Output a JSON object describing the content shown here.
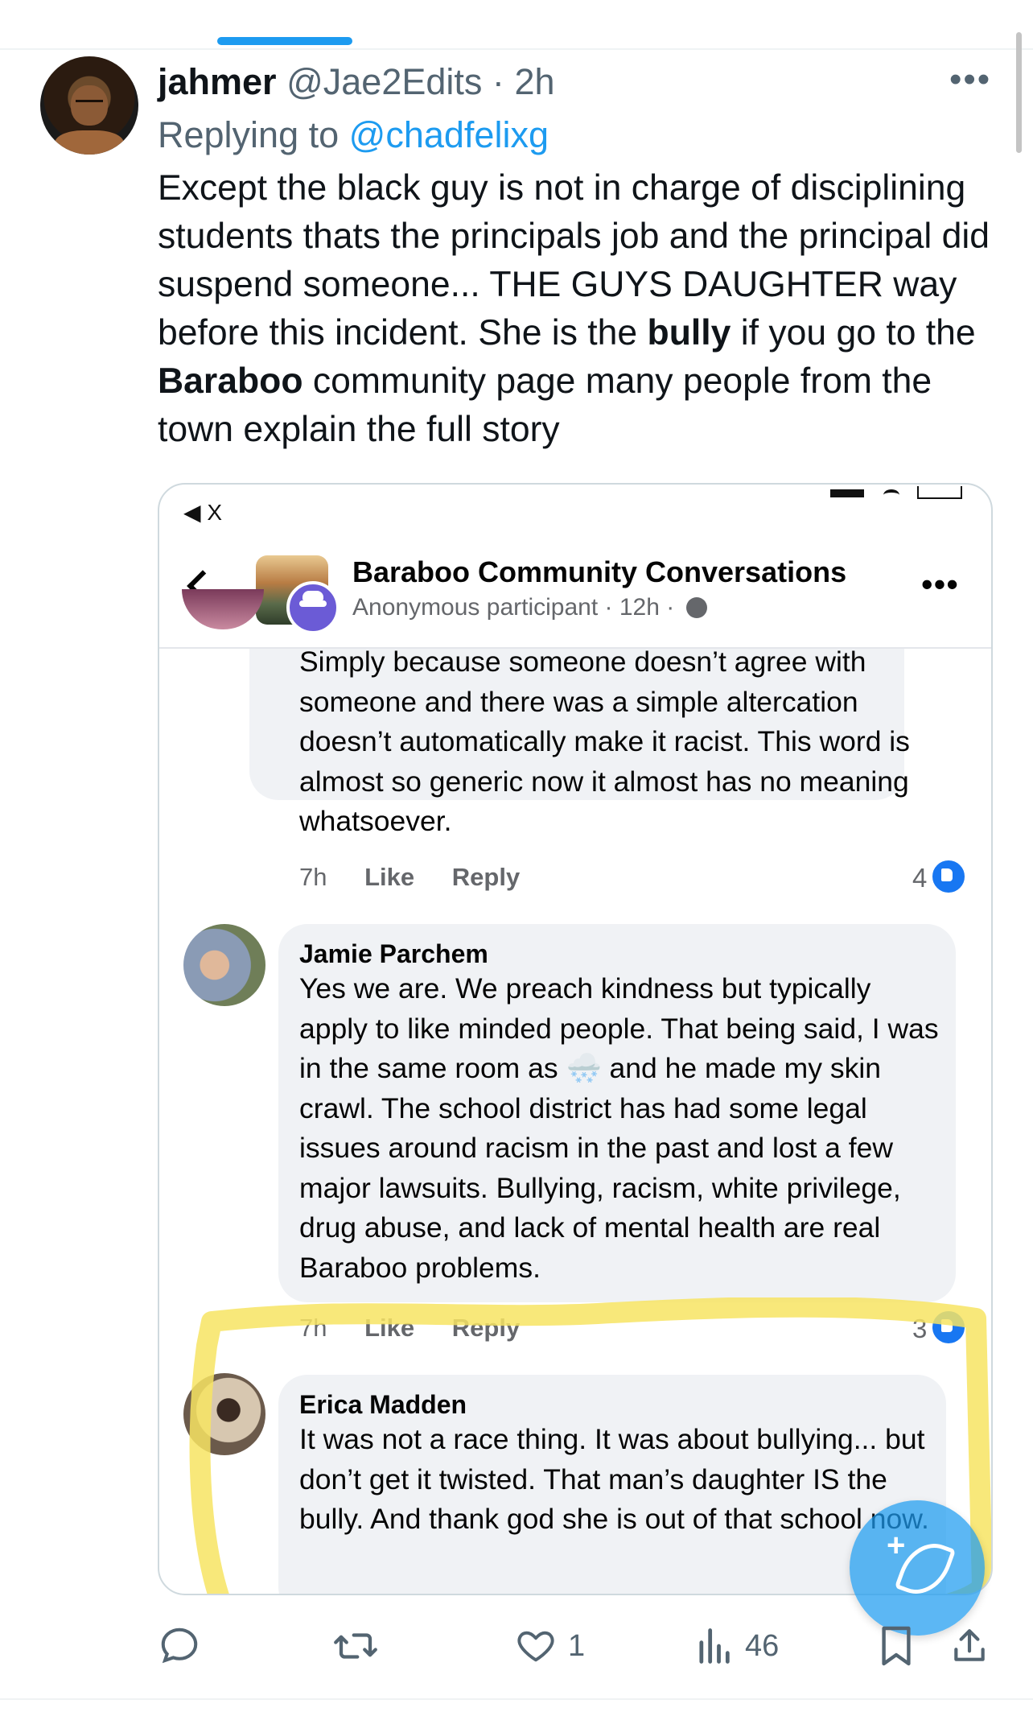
{
  "tweet": {
    "display_name": "jahmer",
    "handle": "@Jae2Edits",
    "separator": "·",
    "time": "2h",
    "replying_label": "Replying to",
    "replying_handle": "@chadfelixg",
    "text_parts": {
      "p1": "Except the black guy is not in charge of disciplining students thats the principals job and the principal did suspend someone... THE GUYS DAUGHTER way before this incident. She is the ",
      "b1": "bully",
      "p2": " if you go to the ",
      "b2": "Baraboo",
      "p3": " community page many people from the town explain the full story"
    },
    "more_icon": "more-horizontal-icon"
  },
  "screenshot": {
    "status_left": "◀ X",
    "group_name": "Baraboo Community Conversations",
    "poster": "Anonymous participant",
    "post_time": "12h",
    "separator": "·",
    "comments": [
      {
        "author": "",
        "text": "Simply because someone doesn’t agree with someone and there was a simple altercation doesn’t automatically make it racist. This word is almost so generic now it almost has no meaning whatsoever.",
        "age": "7h",
        "like_label": "Like",
        "reply_label": "Reply",
        "reactions": "4"
      },
      {
        "author": "Jamie Parchem",
        "text_before_emoji": "Yes we are. We preach kindness but typically apply to like minded people. That being said, I was in the same room as ",
        "emoji": "🌨️",
        "text_after_emoji": " and he made my skin crawl. The school district has had some legal issues around racism in the past and lost a few major lawsuits. Bullying, racism, white privilege, drug abuse, and lack of mental health are real Baraboo problems.",
        "age": "7h",
        "like_label": "Like",
        "reply_label": "Reply",
        "reactions": "3"
      },
      {
        "author": "Erica Madden",
        "text": "It was not a race thing. It was about bullying... but don’t get it twisted. That man’s daughter IS the bully. And thank god she is out of that school now."
      }
    ],
    "highlight_color": "#f7e463"
  },
  "actions": {
    "reply_count": "",
    "retweet_count": "",
    "like_count": "1",
    "views_count": "46"
  },
  "colors": {
    "accent": "#1d9bf0",
    "secondary_text": "#536471",
    "fb_like_blue": "#1877f2"
  }
}
